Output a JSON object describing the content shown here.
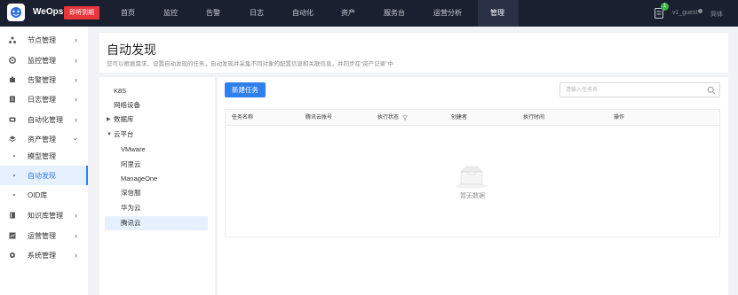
{
  "header": {
    "brand": "WeOps",
    "badge": "即将到期",
    "nav": [
      "首页",
      "监控",
      "告警",
      "日志",
      "自动化",
      "资产",
      "服务台",
      "运营分析",
      "管理"
    ],
    "active_nav": "管理",
    "notification_count": "1",
    "user": "v1_guest",
    "language": "简体"
  },
  "sidebar": {
    "items": [
      {
        "label": "节点管理",
        "icon": "node-icon"
      },
      {
        "label": "监控管理",
        "icon": "monitor-icon"
      },
      {
        "label": "告警管理",
        "icon": "alarm-icon"
      },
      {
        "label": "日志管理",
        "icon": "log-icon"
      },
      {
        "label": "自动化管理",
        "icon": "automation-icon"
      },
      {
        "label": "资产管理",
        "icon": "asset-icon"
      }
    ],
    "sub_items": [
      "模型管理",
      "自动发现",
      "OID库"
    ],
    "active_sub": "自动发现",
    "bottom_items": [
      {
        "label": "知识库管理",
        "icon": "knowledge-icon"
      },
      {
        "label": "运营管理",
        "icon": "operation-icon"
      },
      {
        "label": "系统管理",
        "icon": "system-icon"
      }
    ]
  },
  "page": {
    "title": "自动发现",
    "description": "您可以根据需求，设置自动发现的任务，自动发现并采集不同对象的配置信息和关联信息，并同步在“资产记录”中"
  },
  "tree": {
    "nodes": [
      "K8S",
      "网络设备",
      "数据库",
      "云平台",
      "VMware",
      "阿里云",
      "ManageOne",
      "深信服",
      "华为云",
      "腾讯云"
    ],
    "selected": "腾讯云"
  },
  "toolbar": {
    "new_task": "新建任务",
    "search_placeholder": "请输入任务名"
  },
  "table": {
    "columns": [
      "任务名称",
      "腾讯云账号",
      "执行状态",
      "创建者",
      "执行时间",
      "操作"
    ],
    "empty_text": "暂无数据"
  },
  "colors": {
    "topbar": "#1b2030",
    "accent": "#2f80ed",
    "badge": "#e8363b",
    "notify": "#3fb64b"
  }
}
